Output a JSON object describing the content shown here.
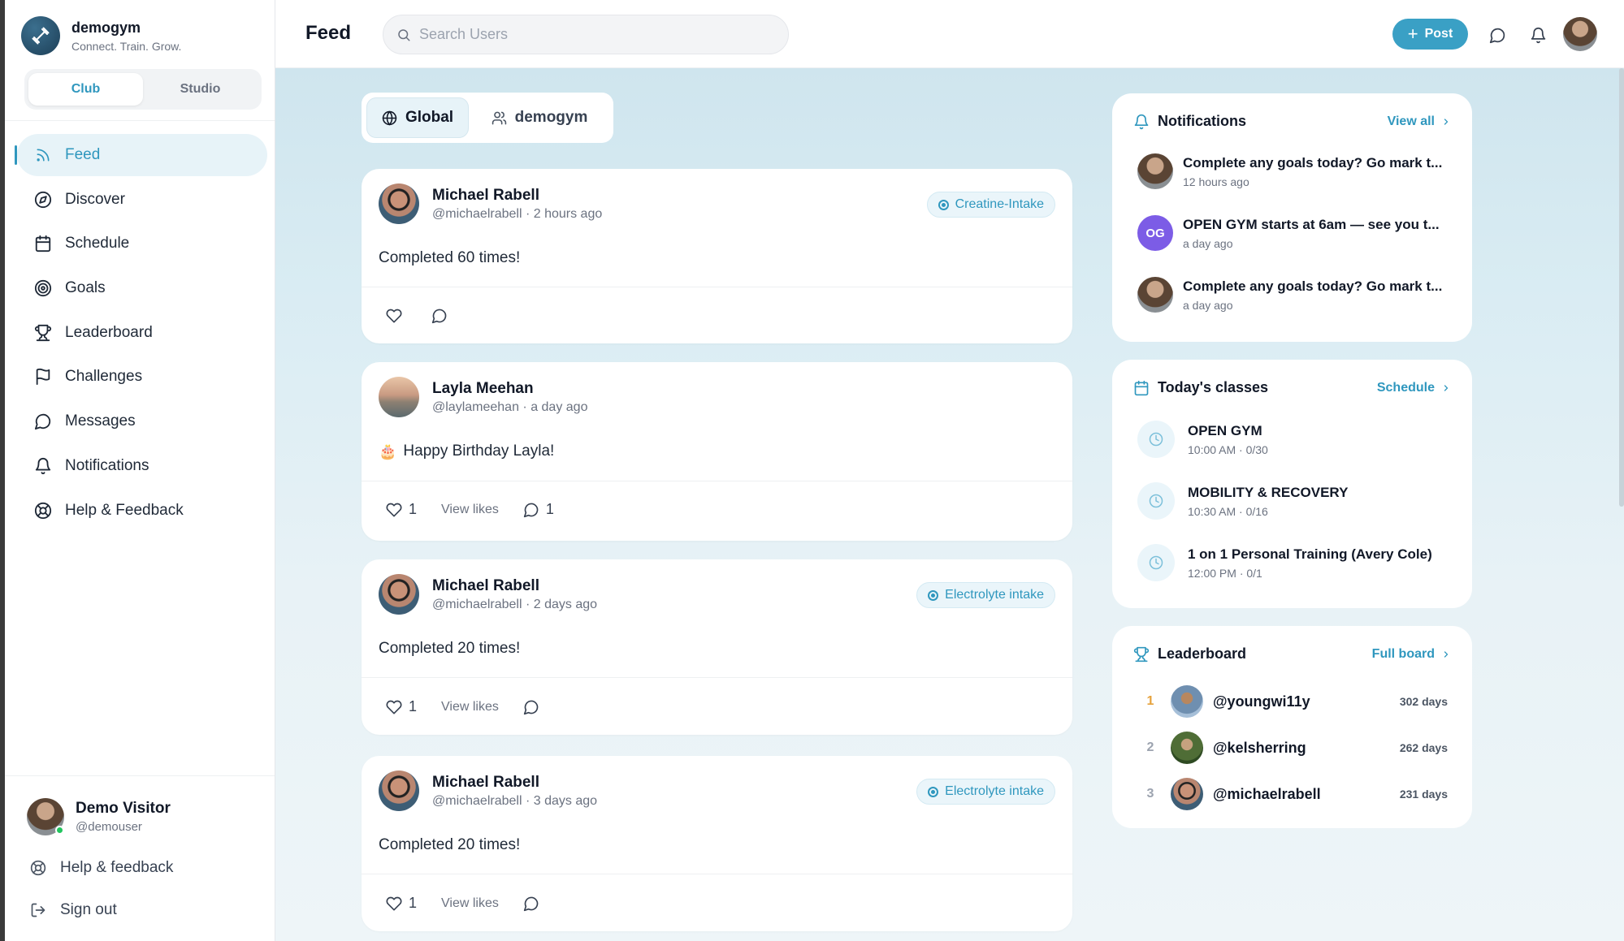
{
  "brand": {
    "name": "demogym",
    "tagline": "Connect. Train. Grow."
  },
  "club_toggle": {
    "options": [
      "Club",
      "Studio"
    ],
    "selected": "Club"
  },
  "sidebar": {
    "items": [
      {
        "label": "Feed",
        "icon": "rss-icon",
        "active": true
      },
      {
        "label": "Discover",
        "icon": "compass-icon"
      },
      {
        "label": "Schedule",
        "icon": "calendar-icon"
      },
      {
        "label": "Goals",
        "icon": "target-icon"
      },
      {
        "label": "Leaderboard",
        "icon": "trophy-icon"
      },
      {
        "label": "Challenges",
        "icon": "flag-icon"
      },
      {
        "label": "Messages",
        "icon": "chat-icon"
      },
      {
        "label": "Notifications",
        "icon": "bell-icon"
      },
      {
        "label": "Help & Feedback",
        "icon": "lifebuoy-icon"
      }
    ],
    "user": {
      "name": "Demo Visitor",
      "handle": "@demouser",
      "online": true
    },
    "help_link": "Help & feedback",
    "signout_link": "Sign out"
  },
  "header": {
    "title": "Feed",
    "search_placeholder": "Search Users",
    "post_label": "Post",
    "accent": "#3aa0c5"
  },
  "feed_switch": {
    "options": [
      "Global",
      "demogym"
    ],
    "selected": "Global"
  },
  "posts": [
    {
      "author": "Michael Rabell",
      "handle": "@michaelrabell",
      "time": "2 hours ago",
      "tag": "Creatine-Intake",
      "body": "Completed 60 times!",
      "likes": "",
      "comments": ""
    },
    {
      "author": "Layla Meehan",
      "handle": "@laylameehan",
      "time": "a day ago",
      "tag": "",
      "emoji": "🎂",
      "body": "Happy Birthday Layla!",
      "likes": "1",
      "view_likes": "View likes",
      "comments": "1"
    },
    {
      "author": "Michael Rabell",
      "handle": "@michaelrabell",
      "time": "2 days ago",
      "tag": "Electrolyte intake",
      "body": "Completed 20 times!",
      "likes": "1",
      "view_likes": "View likes",
      "comments": ""
    },
    {
      "author": "Michael Rabell",
      "handle": "@michaelrabell",
      "time": "3 days ago",
      "tag": "Electrolyte intake",
      "body": "Completed 20 times!",
      "likes": "1",
      "view_likes": "View likes",
      "comments": ""
    }
  ],
  "notifications": {
    "title": "Notifications",
    "link": "View all",
    "items": [
      {
        "text": "Complete any goals today? Go mark t...",
        "time": "12 hours ago",
        "avatar": "photo"
      },
      {
        "text": "OPEN GYM starts at 6am — see you t...",
        "time": "a day ago",
        "avatar": "OG"
      },
      {
        "text": "Complete any goals today? Go mark t...",
        "time": "a day ago",
        "avatar": "photo"
      }
    ]
  },
  "classes": {
    "title": "Today's classes",
    "link": "Schedule",
    "items": [
      {
        "name": "OPEN GYM",
        "detail": "10:00 AM · 0/30"
      },
      {
        "name": "MOBILITY & RECOVERY",
        "detail": "10:30 AM · 0/16"
      },
      {
        "name": "1 on 1 Personal Training (Avery Cole)",
        "detail": "12:00 PM · 0/1"
      }
    ]
  },
  "leaderboard": {
    "title": "Leaderboard",
    "link": "Full board",
    "rows": [
      {
        "rank": "1",
        "name": "@youngwi11y",
        "days": "302 days"
      },
      {
        "rank": "2",
        "name": "@kelsherring",
        "days": "262 days"
      },
      {
        "rank": "3",
        "name": "@michaelrabell",
        "days": "231 days"
      }
    ]
  }
}
